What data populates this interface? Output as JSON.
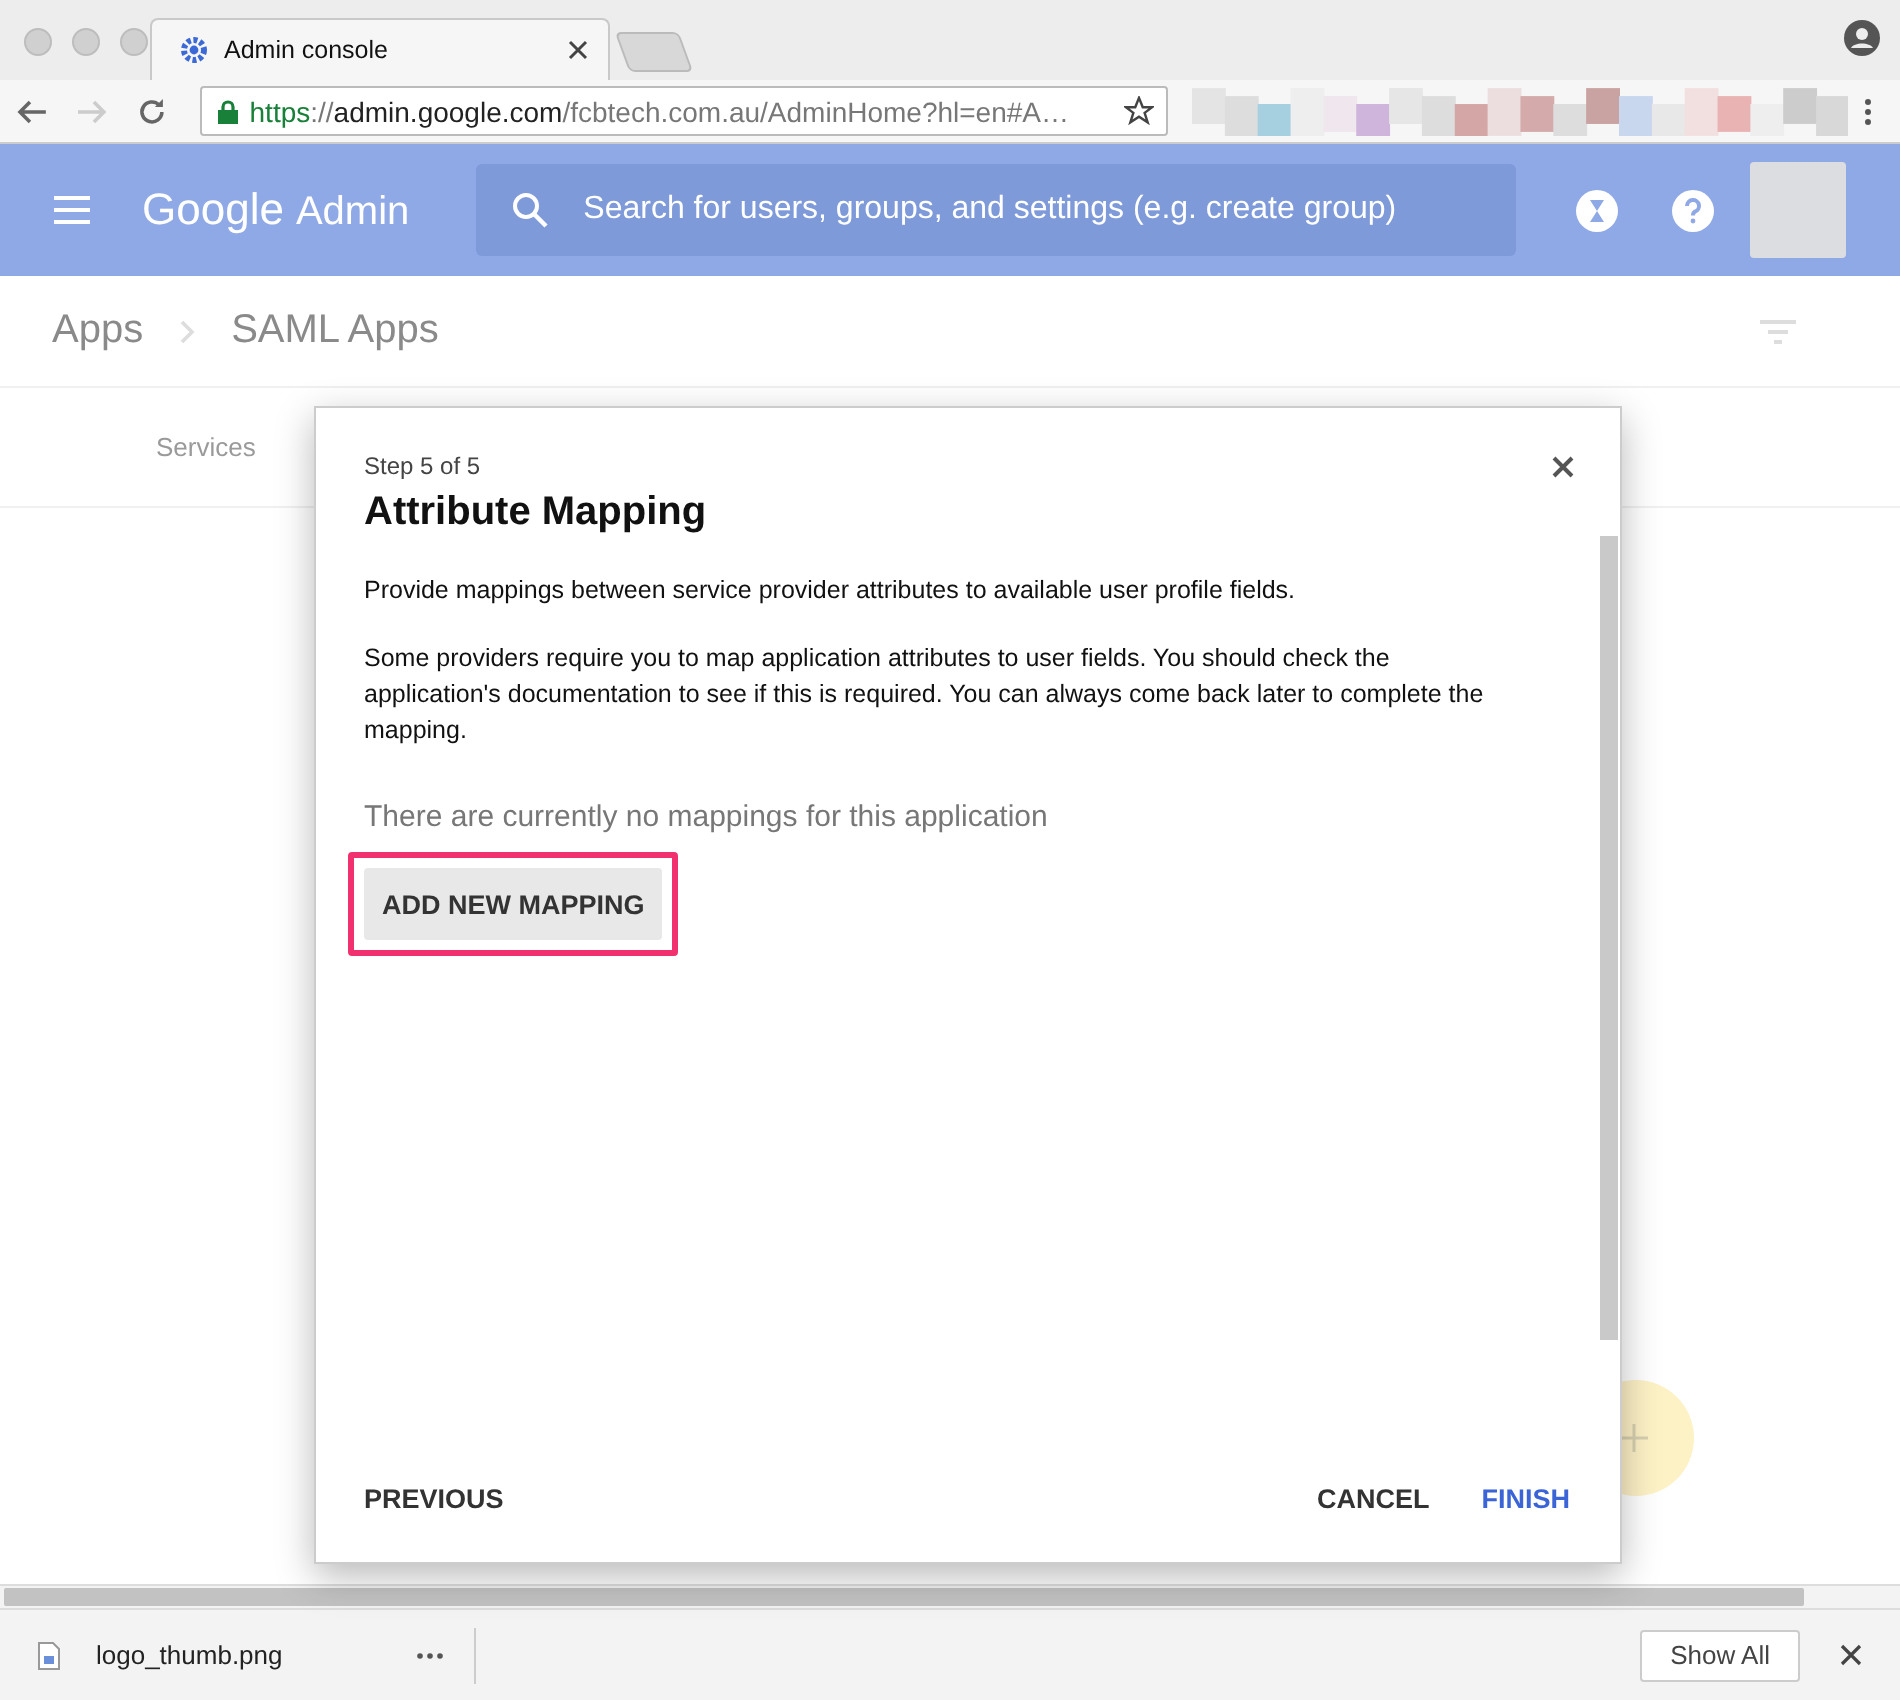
{
  "browser": {
    "tab_title": "Admin console",
    "url": {
      "scheme": "https",
      "separator": "://",
      "host": "admin.google.com",
      "path": "/fcbtech.com.au/AdminHome?hl=en#A…"
    }
  },
  "app_bar": {
    "logo": "Google",
    "product": "Admin",
    "search": {
      "placeholder": "Search for users, groups, and settings (e.g. create group)"
    }
  },
  "breadcrumb": [
    {
      "label": "Apps"
    },
    {
      "label": "SAML Apps"
    }
  ],
  "subnav": {
    "label": "Services"
  },
  "dialog": {
    "step": "Step 5 of 5",
    "title": "Attribute Mapping",
    "paragraphs": [
      "Provide mappings between service provider attributes to available user profile fields.",
      "Some providers require you to map application attributes to user fields. You should check the application's documentation to see if this is required. You can always come back later to complete the mapping."
    ],
    "empty_message": "There are currently no mappings for this application",
    "add_button": {
      "label": "ADD NEW MAPPING",
      "highlighted": true
    },
    "actions": [
      {
        "label": "PREVIOUS",
        "kind": "secondary"
      },
      {
        "label": "CANCEL",
        "kind": "secondary"
      },
      {
        "label": "FINISH",
        "kind": "primary"
      }
    ]
  },
  "download_bar": {
    "file": "logo_thumb.png",
    "button": "Show All"
  }
}
